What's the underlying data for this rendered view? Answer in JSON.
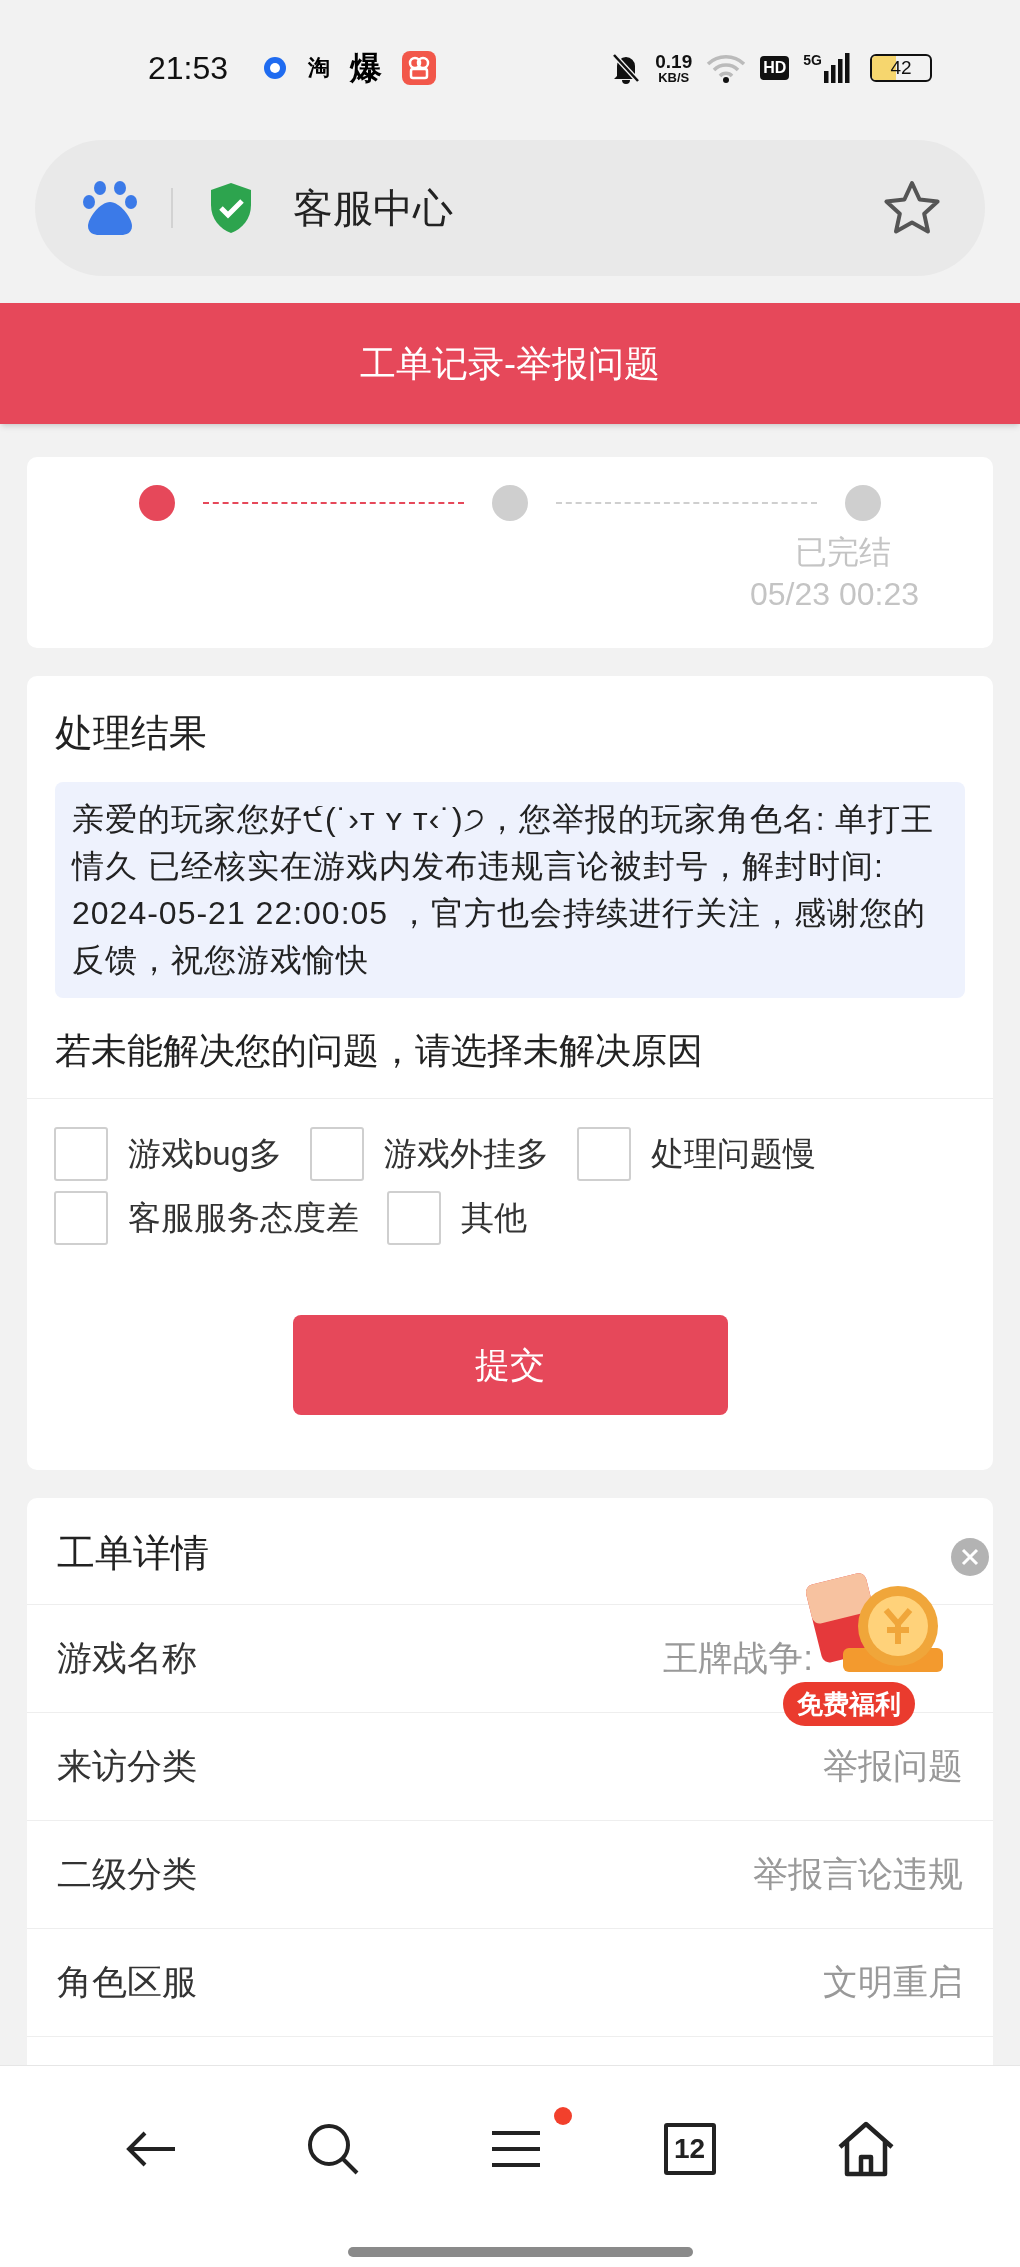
{
  "status_bar": {
    "time": "21:53",
    "app_icons": [
      {
        "kind": "ring"
      },
      {
        "kind": "glyph",
        "text": "淘"
      },
      {
        "kind": "glyph",
        "text": "爆"
      },
      {
        "kind": "camera"
      }
    ],
    "net_speed": "0.19",
    "net_unit": "KB/S",
    "hd": "HD",
    "network": "5G",
    "battery": "42"
  },
  "address_bar": {
    "title": "客服中心"
  },
  "header": {
    "title": "工单记录-举报问题"
  },
  "progress": {
    "steps": [
      {
        "reached": true
      },
      {
        "reached": false
      },
      {
        "reached": false,
        "label": "已完结",
        "time": "05/23 00:23"
      }
    ]
  },
  "result": {
    "title": "处理结果",
    "message": "亲爱的玩家您好੯(˙›ᴛ ʏ ᴛ‹˙)੭，您举报的玩家角色名: 单打王情久 已经核实在游戏内发布违规言论被封号，解封时间: 2024-05-21 22:00:05 ，官方也会持续进行关注，感谢您的反馈，祝您游戏愉快",
    "question": "若未能解决您的问题，请选择未解决原因",
    "reasons": [
      {
        "label": "游戏bug多",
        "checked": false
      },
      {
        "label": "游戏外挂多",
        "checked": false
      },
      {
        "label": "处理问题慢",
        "checked": false
      },
      {
        "label": "客服服务态度差",
        "checked": false
      },
      {
        "label": "其他",
        "checked": false
      }
    ],
    "submit": "提交"
  },
  "details": {
    "title": "工单详情",
    "rows": [
      {
        "label": "游戏名称",
        "value": "王牌战争:"
      },
      {
        "label": "来访分类",
        "value": "举报问题"
      },
      {
        "label": "二级分类",
        "value": "举报言论违规"
      },
      {
        "label": "角色区服",
        "value": "文明重启"
      }
    ]
  },
  "promo": {
    "label": "免费福利"
  },
  "bottom_nav": [
    {
      "kind": "back"
    },
    {
      "kind": "search"
    },
    {
      "kind": "menu",
      "badge": true
    },
    {
      "kind": "tabs",
      "text": "12"
    },
    {
      "kind": "home"
    }
  ]
}
